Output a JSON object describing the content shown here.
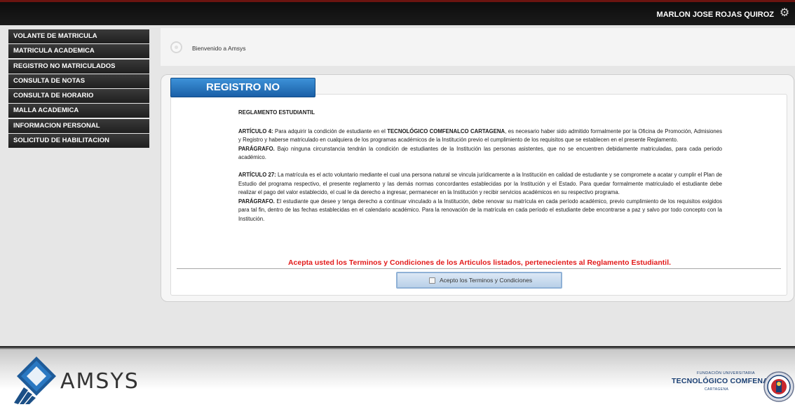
{
  "header": {
    "user_name": "MARLON JOSE ROJAS QUIROZ",
    "settings_icon": "gear-icon"
  },
  "sidebar": {
    "items": [
      {
        "label": "VOLANTE DE MATRICULA"
      },
      {
        "label": "MATRICULA ACADEMICA"
      },
      {
        "label": "REGISTRO NO MATRICULADOS"
      },
      {
        "label": "CONSULTA DE NOTAS"
      },
      {
        "label": "CONSULTA DE HORARIO"
      },
      {
        "label": "MALLA ACADEMICA"
      },
      {
        "label": "INFORMACION PERSONAL"
      },
      {
        "label": "SOLICITUD DE HABILITACION"
      }
    ]
  },
  "welcome": {
    "text": "Bienvenido a Amsys"
  },
  "panel": {
    "title": "REGISTRO NO MATRICULADOS",
    "title_color": "#2a78c2"
  },
  "document": {
    "heading": "REGLAMENTO ESTUDIANTIL",
    "art4_label": "ARTÍCULO 4:",
    "art4_text_a": " Para adquirir la condición de estudiante en el ",
    "art4_institution": "TECNOLÓGICO COMFENALCO CARTAGENA",
    "art4_text_b": ", es necesario haber sido admitido formalmente por la Oficina de Promoción, Admisiones y Registro y haberse matriculado en cualquiera de los programas académicos de la Institución previo el cumplimiento de los requisitos que se establecen en el presente Reglamento.",
    "par1_label": "PARÁGRAFO.",
    "par1_text": " Bajo ninguna circunstancia tendrán la condición de estudiantes de la Institución las personas asistentes, que no se encuentren debidamente matriculadas, para cada periodo académico.",
    "art27_label": "ARTÍCULO 27:",
    "art27_text": " La matrícula es el acto voluntario mediante el cual una persona natural se vincula jurídicamente a la Institución en calidad de estudiante y se compromete a acatar y cumplir el Plan de Estudio del programa respectivo, el presente reglamento y las demás normas concordantes establecidas por la Institución y el Estado. Para quedar formalmente matriculado el estudiante debe realizar el pago del valor establecido, el cual le da derecho a ingresar, permanecer en la Institución y recibir servicios académicos en su respectivo programa.",
    "par2_label": "PARÁGRAFO.",
    "par2_text": " El estudiante que desee y tenga derecho a continuar vinculado a la Institución, debe renovar su matrícula en cada período académico, previo cumplimiento de los requisitos exigidos para tal fin, dentro de las fechas establecidas en el calendario académico. Para la renovación de la matrícula en cada período el estudiante debe encontrarse a paz y salvo por todo concepto con la Institución."
  },
  "acceptance": {
    "prompt": "Acepta usted los Terminos y Condiciones de los Articulos listados, pertenecientes al Reglamento Estudiantil.",
    "prompt_color": "#e21b1b",
    "checkbox_label": "Acepto los Terminos y Condiciones",
    "checked": false
  },
  "footer": {
    "brand": "AMSYS",
    "partner_line1": "FUNDACIÓN UNIVERSITARIA",
    "partner_line2": "TECNOLÓGICO COMFENALCO",
    "partner_line3": "CARTAGENA"
  }
}
